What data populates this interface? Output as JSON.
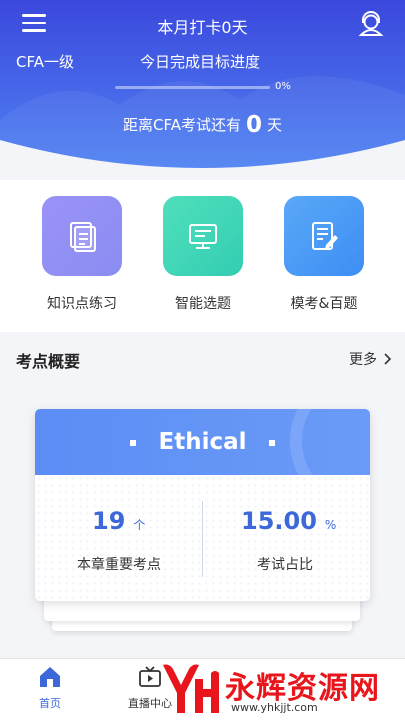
{
  "header": {
    "title": "本月打卡0天",
    "level": "CFA一级",
    "goal_label": "今日完成目标进度",
    "progress_percent": 0,
    "progress_text": "0%",
    "countdown_prefix": "距离CFA考试还有",
    "countdown_days": "0",
    "countdown_suffix": "天"
  },
  "quick_actions": [
    {
      "label": "知识点练习",
      "icon": "document-stack-icon",
      "color": "#8f8bf4"
    },
    {
      "label": "智能选题",
      "icon": "monitor-icon",
      "color": "#3ed7b5"
    },
    {
      "label": "模考&百题",
      "icon": "exam-edit-icon",
      "color": "#4a9cf7"
    }
  ],
  "overview": {
    "title": "考点概要",
    "more": "更多",
    "card": {
      "title": "Ethical",
      "points_value": "19",
      "points_unit": "个",
      "points_label": "本章重要考点",
      "ratio_value": "15.00",
      "ratio_unit": "%",
      "ratio_label": "考试占比"
    }
  },
  "tabs": [
    {
      "label": "首页",
      "icon": "home-icon",
      "active": true
    },
    {
      "label": "直播中心",
      "icon": "live-tv-icon",
      "active": false
    }
  ],
  "watermark": {
    "text": "永辉资源网",
    "url": "www.yhkjjt.com",
    "logo": "yh-logo"
  },
  "colors": {
    "accent": "#3c68d9",
    "header_top": "#3d4fe0",
    "header_bottom": "#4d7bf0"
  }
}
